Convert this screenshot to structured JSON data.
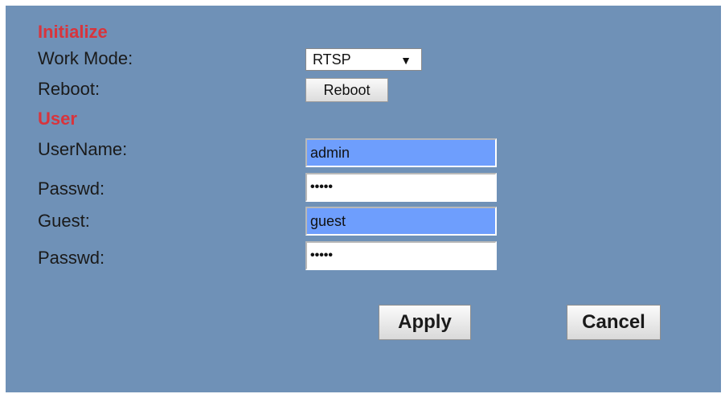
{
  "initialize": {
    "title": "Initialize",
    "work_mode": {
      "label": "Work Mode:",
      "value": "RTSP",
      "arrow_icon": "triangle-down-icon"
    },
    "reboot": {
      "label": "Reboot:",
      "button_label": "Reboot"
    }
  },
  "user": {
    "title": "User",
    "username": {
      "label": "UserName:",
      "value": "admin"
    },
    "passwd": {
      "label": "Passwd:",
      "value": "•••••"
    },
    "guest": {
      "label": "Guest:",
      "value": "guest"
    },
    "guest_passwd": {
      "label": "Passwd:",
      "value": "•••••"
    }
  },
  "actions": {
    "apply_label": "Apply",
    "cancel_label": "Cancel"
  },
  "colors": {
    "panel_background": "#6f91b7",
    "section_title": "#d8343c",
    "autofill_highlight": "#6e9efd"
  }
}
